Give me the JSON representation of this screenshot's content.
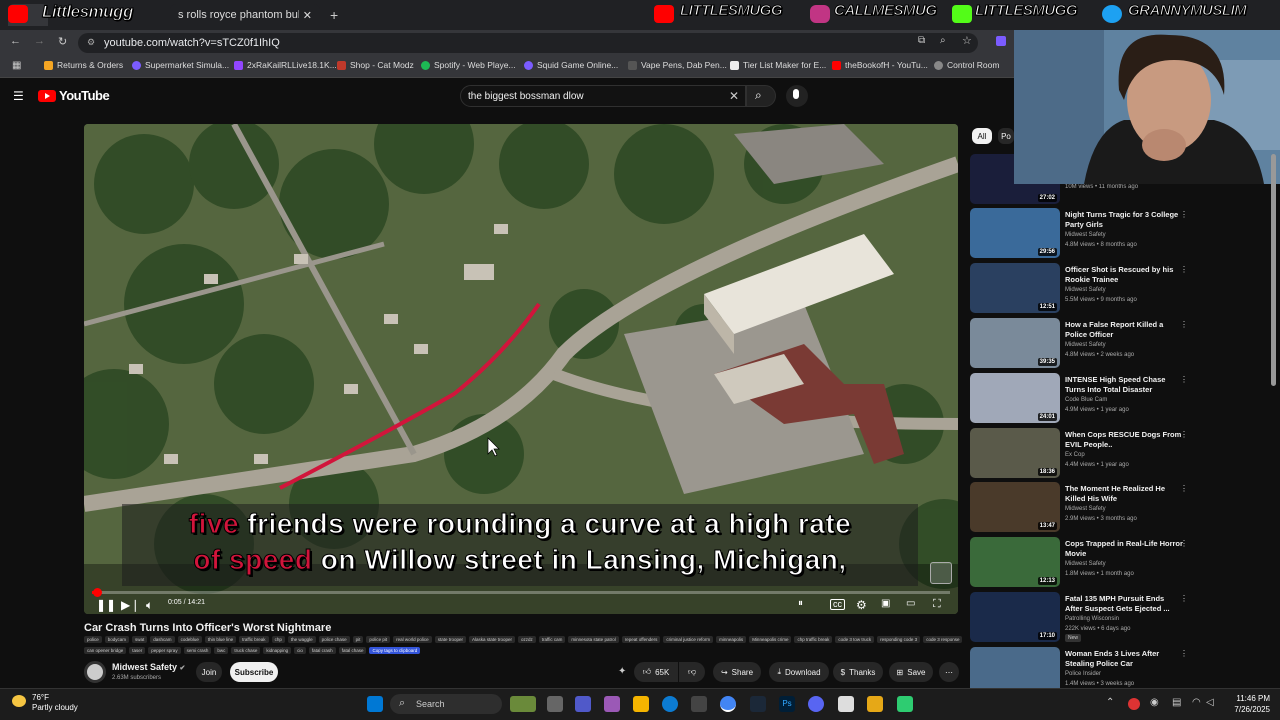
{
  "browser": {
    "tabs": [
      {
        "label": "ar"
      },
      {
        "label": "s rolls royce phantom bulletpr..."
      }
    ],
    "url": "youtube.com/watch?v=sTCZ0f1IhIQ",
    "bookmarks": [
      {
        "label": "Returns & Orders",
        "color": "#f5a623"
      },
      {
        "label": "Supermarket Simula...",
        "color": "#7b5cff"
      },
      {
        "label": "2xRaKailRLLive18.1K...",
        "color": "#9146ff"
      },
      {
        "label": "Shop - Cat Modz",
        "color": "#c0392b"
      },
      {
        "label": "Spotify - Web Playe...",
        "color": "#1db954"
      },
      {
        "label": "Squid Game Online...",
        "color": "#7b5cff"
      },
      {
        "label": "Vape Pens, Dab Pen...",
        "color": "#555555"
      },
      {
        "label": "Tier List Maker for E...",
        "color": "#333333"
      },
      {
        "label": "theBookofH - YouTu...",
        "color": "#ff0000"
      },
      {
        "label": "Control Room",
        "color": "#888888"
      }
    ]
  },
  "stream_overlay": {
    "left_name": "Littlesmugg",
    "handles": [
      "LITTLESMUGG",
      "CALLMESMUG",
      "LITTLESMUGG",
      "GRANNYMUSLIM"
    ],
    "colors": {
      "youtube": "#ff0000",
      "instagram": "#c13584",
      "kick": "#53fc18",
      "twitter": "#1da1f2"
    }
  },
  "youtube": {
    "logo": "YouTube",
    "search_query": "the biggest bossman dlow",
    "subtitle_parts": [
      {
        "text": "five",
        "highlight": true
      },
      {
        "text": " friends were rounding a curve at a high rate",
        "highlight": false
      },
      {
        "text": "of speed",
        "highlight": true
      },
      {
        "text": " on Willow street in Lansing, Michigan,",
        "highlight": false
      }
    ],
    "time": "0:05 / 14:21",
    "progress": 0.006,
    "video_title": "Car Crash Turns Into Officer's Worst Nightmare",
    "tags": [
      "police",
      "bodycam",
      "swat",
      "dashcam",
      "codeblue",
      "thin blue line",
      "traffic break",
      "chp",
      "the waggle",
      "police chase",
      "pit",
      "police pit",
      "real world police",
      "state trooper",
      "Alaska state trooper",
      "ozzdz",
      "traffic cam",
      "minnesota state patrol",
      "repeat offenders",
      "criminal justice reform",
      "minneapolis",
      "Minneapolis crime",
      "chp traffic break",
      "code 3 tow truck",
      "responding code 3",
      "code 3 response",
      "can opener bridge",
      "taser",
      "pepper spray",
      "semi crash",
      "bwc",
      "truck chase",
      "kidnapping",
      "cio",
      "fatal crash",
      "fatal chase",
      "Copy tags to clipboard"
    ],
    "channel": "Midwest Safety",
    "subscribers": "2.63M subscribers",
    "join_label": "Join",
    "subscribe_label": "Subscribe",
    "likes": "65K",
    "share_label": "Share",
    "download_label": "Download",
    "thanks_label": "Thanks",
    "save_label": "Save",
    "chips": [
      "All",
      "Po"
    ],
    "recommendations": [
      {
        "title": "",
        "channel": "",
        "meta": "10M views • 11 months ago",
        "duration": "27:02",
        "bg": "#1a1e3a"
      },
      {
        "title": "Night Turns Tragic for 3 College Party Girls",
        "channel": "Midwest Safety",
        "meta": "4.8M views • 8 months ago",
        "duration": "29:56",
        "bg": "#3a6a9a"
      },
      {
        "title": "Officer Shot is Rescued by his Rookie Trainee",
        "channel": "Midwest Safety",
        "meta": "5.5M views • 9 months ago",
        "duration": "12:51",
        "bg": "#2a4060"
      },
      {
        "title": "How a False Report Killed a Police Officer",
        "channel": "Midwest Safety",
        "meta": "4.8M views • 2 weeks ago",
        "duration": "39:35",
        "bg": "#7a8a9a"
      },
      {
        "title": "INTENSE High Speed Chase Turns Into Total Disaster",
        "channel": "Code Blue Cam",
        "meta": "4.9M views • 1 year ago",
        "duration": "24:01",
        "bg": "#a0a8b8"
      },
      {
        "title": "When Cops RESCUE Dogs From EVIL People..",
        "channel": "Ex Cop",
        "meta": "4.4M views • 1 year ago",
        "duration": "18:36",
        "bg": "#5a5a4a"
      },
      {
        "title": "The Moment He Realized He Killed His Wife",
        "channel": "Midwest Safety",
        "meta": "2.9M views • 3 months ago",
        "duration": "13:47",
        "bg": "#4a3a2a"
      },
      {
        "title": "Cops Trapped in Real-Life Horror Movie",
        "channel": "Midwest Safety",
        "meta": "1.8M views • 1 month ago",
        "duration": "12:13",
        "bg": "#3a6a3a"
      },
      {
        "title": "Fatal 135 MPH Pursuit Ends After Suspect Gets Ejected ...",
        "channel": "Patrolling Wisconsin",
        "meta": "222K views • 6 days ago",
        "duration": "17:10",
        "bg": "#1a2a4a",
        "badge": "New"
      },
      {
        "title": "Woman Ends 3 Lives After Stealing Police Car",
        "channel": "Police Insider",
        "meta": "1.4M views • 3 weeks ago",
        "duration": "",
        "bg": "#4a6a8a"
      }
    ]
  },
  "taskbar": {
    "temperature": "76°F",
    "weather": "Partly cloudy",
    "search_label": "Search",
    "time": "11:46 PM",
    "date": "7/26/2025"
  }
}
